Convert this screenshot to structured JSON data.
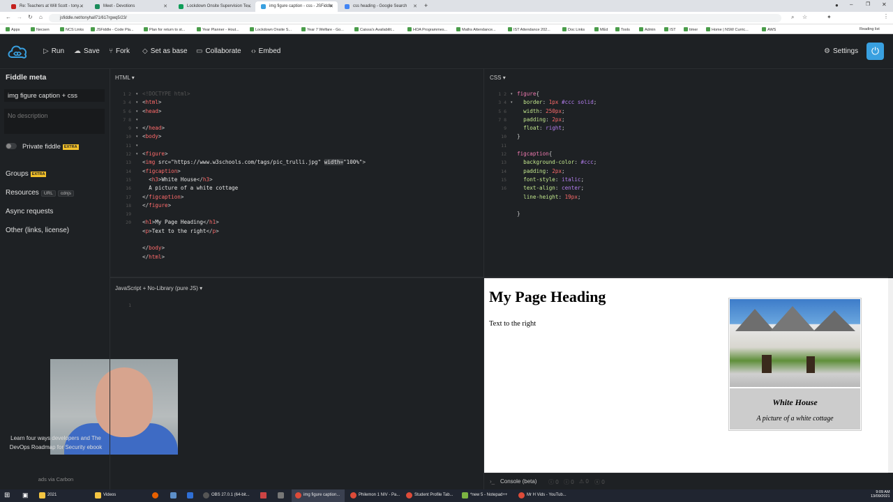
{
  "browser": {
    "tabs": [
      {
        "label": "Re: Teachers at Will Scott - tony..."
      },
      {
        "label": "Meet - Devotions"
      },
      {
        "label": "Lockdown Onsite Supervision Te..."
      },
      {
        "label": "img figure caption - css - JSFiddle"
      },
      {
        "label": "css heading - Google Search"
      }
    ],
    "url": "jsfiddle.net/tonyhall71/617rgwq5/23/",
    "bookmarks": [
      "Apps",
      "Necsen",
      "NCS Links",
      "JSFiddle - Code Pla...",
      "Plan for return to st...",
      "Year Planner - Hout...",
      "Lockdown Onsite S...",
      "Year 7 Welfare - Go...",
      "Caissa's Availabilit...",
      "HOA Programmes...",
      "Maths Attendance...",
      "IST Attendance 202...",
      "Doc Links",
      "MEd",
      "Tools",
      "Admin",
      "IST",
      "timer",
      "Home | NSW Curric...",
      "AWS"
    ],
    "reading_list": "Reading list"
  },
  "header": {
    "run": "Run",
    "save": "Save",
    "fork": "Fork",
    "set_as_base": "Set as base",
    "collaborate": "Collaborate",
    "embed": "Embed",
    "settings": "Settings"
  },
  "sidebar": {
    "heading": "Fiddle meta",
    "title_value": "img figure caption + css",
    "description_placeholder": "No description",
    "private_label": "Private fiddle",
    "extra_badge": "EXTRA",
    "groups": "Groups",
    "resources": "Resources",
    "resources_url": "URL",
    "resources_cdnjs": "cdnjs",
    "async": "Async requests",
    "other": "Other (links, license)",
    "ad_text": "Learn four ways developers and The DevOps Roadmap for Security ebook",
    "ad_footer": "ads via Carbon"
  },
  "panes": {
    "html_label": "HTML",
    "css_label": "CSS",
    "js_label": "JavaScript + No-Library (pure JS)",
    "js_line": "1",
    "console_label": "Console (beta)",
    "console_counts": [
      "0",
      "0",
      "0",
      "0"
    ]
  },
  "result": {
    "heading": "My Page Heading",
    "paragraph": "Text to the right",
    "caption_title": "White House",
    "caption_text": "A picture of a white cottage"
  },
  "taskbar": {
    "items": [
      "2021",
      "Videos",
      "OBS 27.0.1 (64-bit...",
      "img figure caption...",
      "Philemon 1 NIV - Pa...",
      "Student Profile Tab...",
      "*new 5 - Notepad++",
      "Mr H Vids - YouTub..."
    ],
    "time": "9:09 AM",
    "date": "13/09/2021"
  }
}
